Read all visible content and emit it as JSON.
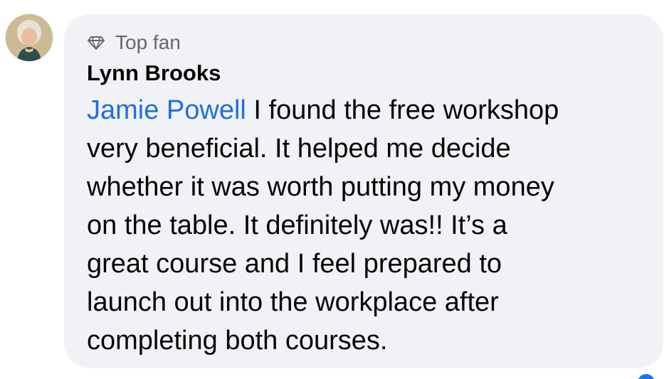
{
  "comment": {
    "badge_icon": "diamond-icon",
    "badge_label": "Top fan",
    "author": "Lynn Brooks",
    "mention": "Jamie Powell",
    "lines": [
      " I found the free workshop",
      "very beneficial. It helped me decide",
      "whether it was worth putting my money",
      "on the table. It definitely was!! It’s a",
      "great course and I feel prepared to",
      "launch out into the workplace after",
      "completing both courses."
    ]
  },
  "avatar": {
    "icon": "user-avatar"
  },
  "colors": {
    "bubble_bg": "#f0f2f5",
    "mention": "#216fdb",
    "badge_text": "#65676b",
    "text": "#050505",
    "reaction": "#1877f2"
  }
}
